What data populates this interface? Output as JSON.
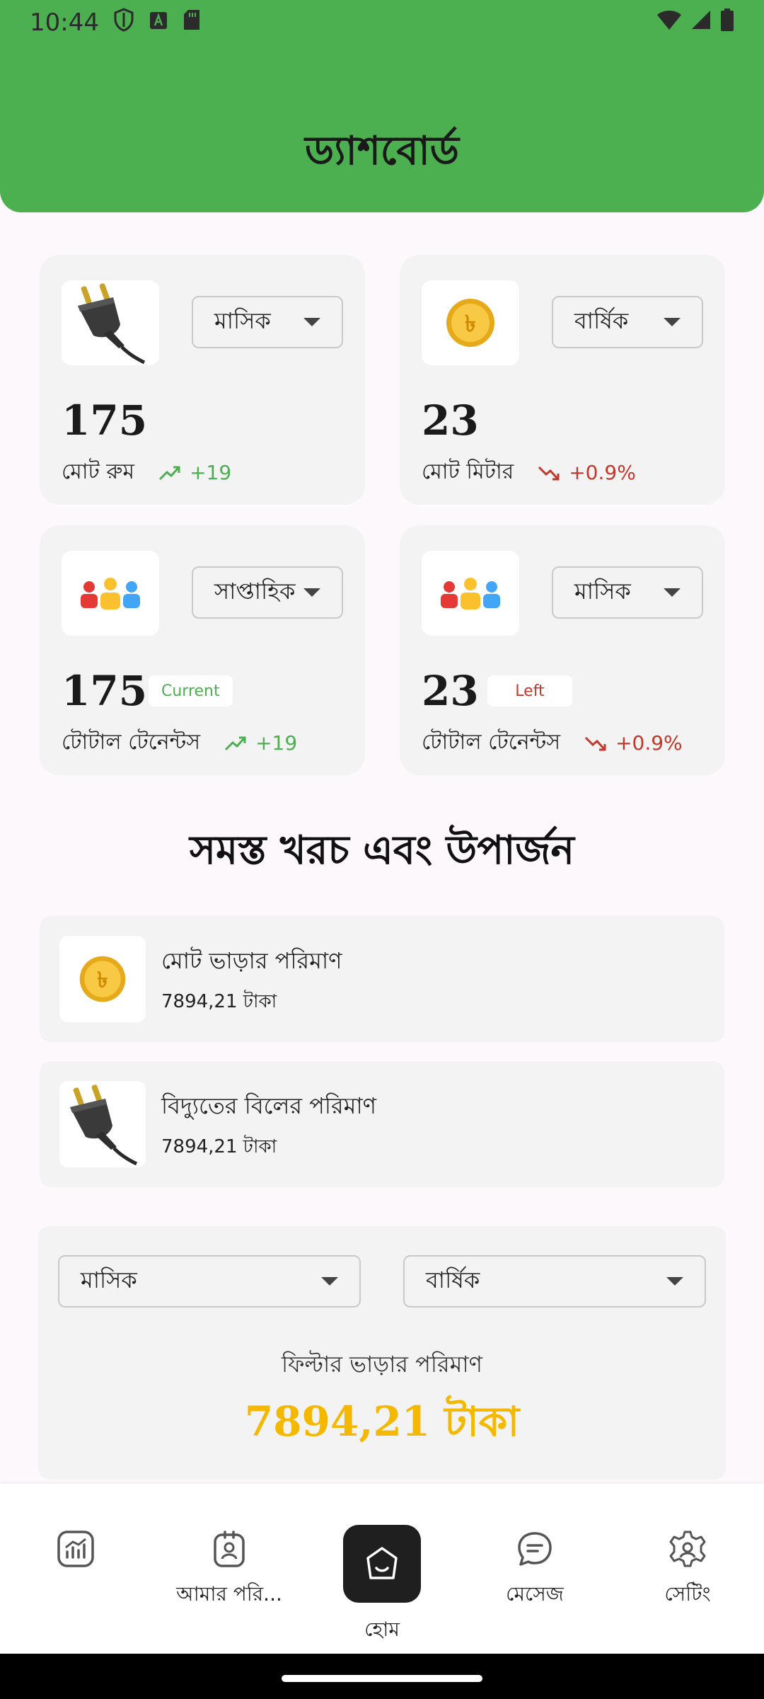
{
  "status_bar": {
    "time": "10:44"
  },
  "header": {
    "title": "ড্যাশবোর্ড"
  },
  "cards": [
    {
      "id": "rooms",
      "icon": "plug-icon",
      "dropdown": "মাসিক",
      "value": "175",
      "label": "মোট রুম",
      "trend": "+19",
      "trend_dir": "up"
    },
    {
      "id": "meters",
      "icon": "taka-coin-icon",
      "dropdown": "বার্ষিক",
      "value": "23",
      "label": "মোট মিটার",
      "trend": "+0.9%",
      "trend_dir": "down"
    },
    {
      "id": "tenants-current",
      "icon": "people-icon",
      "dropdown": "সাপ্তাহিক",
      "value": "175",
      "pill": "Current",
      "label": "টোটাল টেনেন্টস",
      "trend": "+19",
      "trend_dir": "up"
    },
    {
      "id": "tenants-left",
      "icon": "people-icon",
      "dropdown": "মাসিক",
      "value": "23",
      "pill": "Left",
      "label": "টোটাল টেনেন্টস",
      "trend": "+0.9%",
      "trend_dir": "down"
    }
  ],
  "section": {
    "title": "সমস্ত খরচ এবং উপার্জন"
  },
  "amounts": [
    {
      "icon": "taka-coin-icon",
      "title": "মোট ভাড়ার পরিমাণ",
      "value": "7894,21 টাকা"
    },
    {
      "icon": "plug-icon",
      "title": "বিদ্যুতের বিলের পরিমাণ",
      "value": "7894,21 টাকা"
    }
  ],
  "filter": {
    "dropdown_1": "মাসিক",
    "dropdown_2": "বার্ষিক",
    "label": "ফিল্টার ভাড়ার পরিমাণ",
    "value": "7894,21 টাকা"
  },
  "nav": [
    {
      "icon": "chart-icon",
      "label": ""
    },
    {
      "icon": "profile-icon",
      "label": "আমার পরি..."
    },
    {
      "icon": "home-icon",
      "label": "হোম"
    },
    {
      "icon": "message-icon",
      "label": "মেসেজ"
    },
    {
      "icon": "settings-icon",
      "label": "সেটিং"
    }
  ],
  "colors": {
    "header": "#4caf50",
    "accent_amount": "#f5b800",
    "trend_up": "#4caf50",
    "trend_down": "#c0392b"
  }
}
